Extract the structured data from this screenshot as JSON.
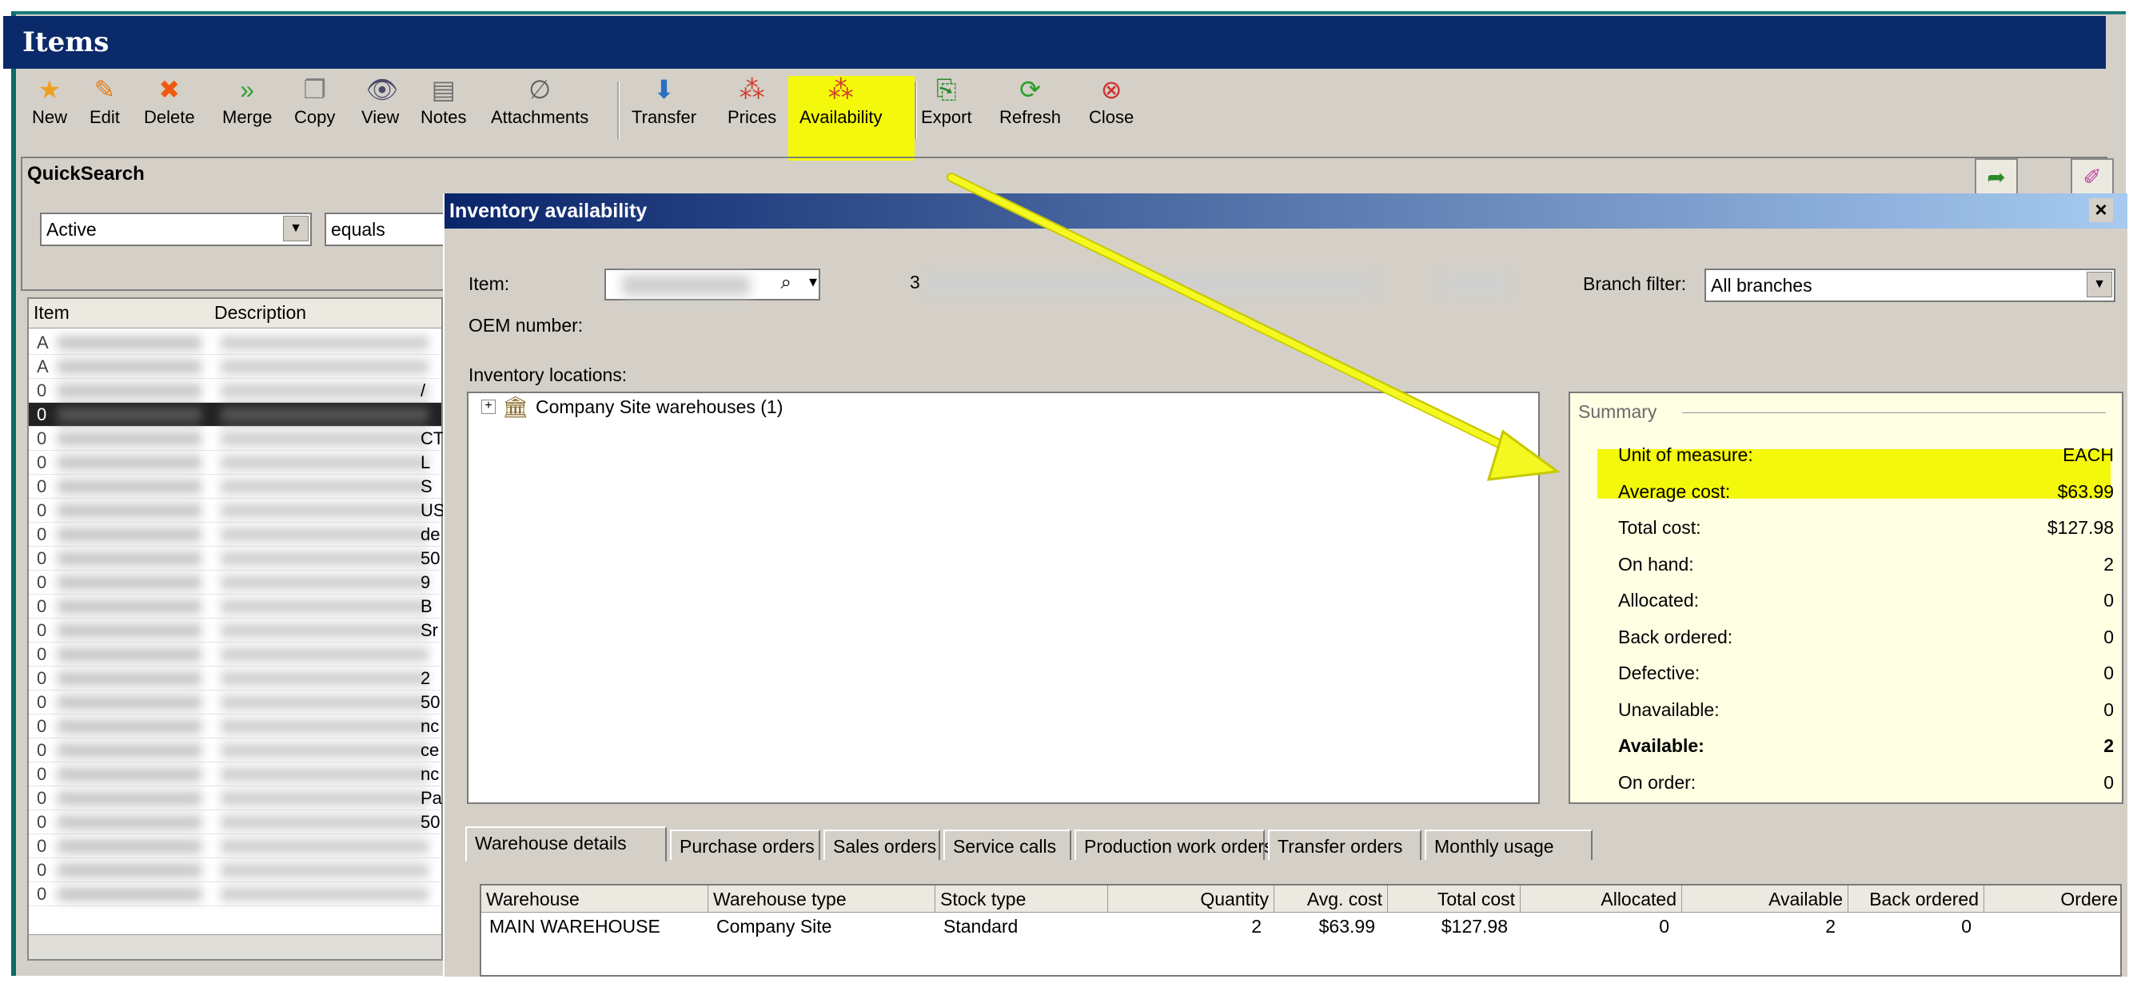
{
  "window": {
    "title": "Items"
  },
  "toolbar": {
    "new": "New",
    "edit": "Edit",
    "delete": "Delete",
    "merge": "Merge",
    "copy": "Copy",
    "view": "View",
    "notes": "Notes",
    "attachments": "Attachments",
    "transfer": "Transfer",
    "prices": "Prices",
    "availability": "Availability",
    "export": "Export",
    "refresh": "Refresh",
    "close": "Close"
  },
  "quicksearch": {
    "label": "QuickSearch",
    "field_value": "Active",
    "operator_value": "equals"
  },
  "items_grid": {
    "columns": [
      "Item",
      "Description"
    ],
    "visible_prefixes": [
      "A",
      "A",
      "0",
      "0",
      "0",
      "0",
      "0",
      "0",
      "0",
      "0",
      "0",
      "0",
      "0",
      "0",
      "0",
      "0",
      "0",
      "0",
      "0",
      "0",
      "0",
      "0",
      "0",
      "0"
    ],
    "partial_desc_fragments": [
      "/",
      "",
      "CT",
      "L",
      "S",
      "US",
      "de",
      "50",
      "9",
      "B",
      "Sr",
      "",
      "2",
      "50",
      "nc",
      "ce",
      "nc",
      "Pa",
      "50"
    ]
  },
  "dialog": {
    "title": "Inventory availability",
    "close_glyph": "×",
    "item_label": "Item:",
    "item_desc_prefix": "3",
    "oem_label": "OEM number:",
    "branch_filter_label": "Branch filter:",
    "branch_filter_value": "All branches",
    "locations_label": "Inventory locations:",
    "tree_root": "Company Site warehouses (1)",
    "summary": {
      "legend": "Summary",
      "rows": [
        {
          "label": "Unit of measure:",
          "value": "EACH"
        },
        {
          "label": "Average cost:",
          "value": "$63.99"
        },
        {
          "label": "Total cost:",
          "value": "$127.98"
        },
        {
          "label": "On hand:",
          "value": "2"
        },
        {
          "label": "Allocated:",
          "value": "0"
        },
        {
          "label": "Back ordered:",
          "value": "0"
        },
        {
          "label": "Defective:",
          "value": "0"
        },
        {
          "label": "Unavailable:",
          "value": "0"
        },
        {
          "label": "Available:",
          "value": "2"
        },
        {
          "label": "On order:",
          "value": "0"
        }
      ]
    },
    "tabs": [
      "Warehouse details",
      "Purchase orders",
      "Sales orders",
      "Service calls",
      "Production work orders",
      "Transfer orders",
      "Monthly usage"
    ],
    "table": {
      "headers": [
        "Warehouse",
        "Warehouse type",
        "Stock type",
        "Quantity",
        "Avg. cost",
        "Total cost",
        "Allocated",
        "Available",
        "Back ordered",
        "Ordere"
      ],
      "row": [
        "MAIN WAREHOUSE",
        "Company Site",
        "Standard",
        "2",
        "$63.99",
        "$127.98",
        "0",
        "2",
        "0",
        ""
      ]
    }
  },
  "colors": {
    "highlight": "#f4f80a",
    "titlebar": "#0a2a6a",
    "annotation_arrow": "#f0f020"
  }
}
